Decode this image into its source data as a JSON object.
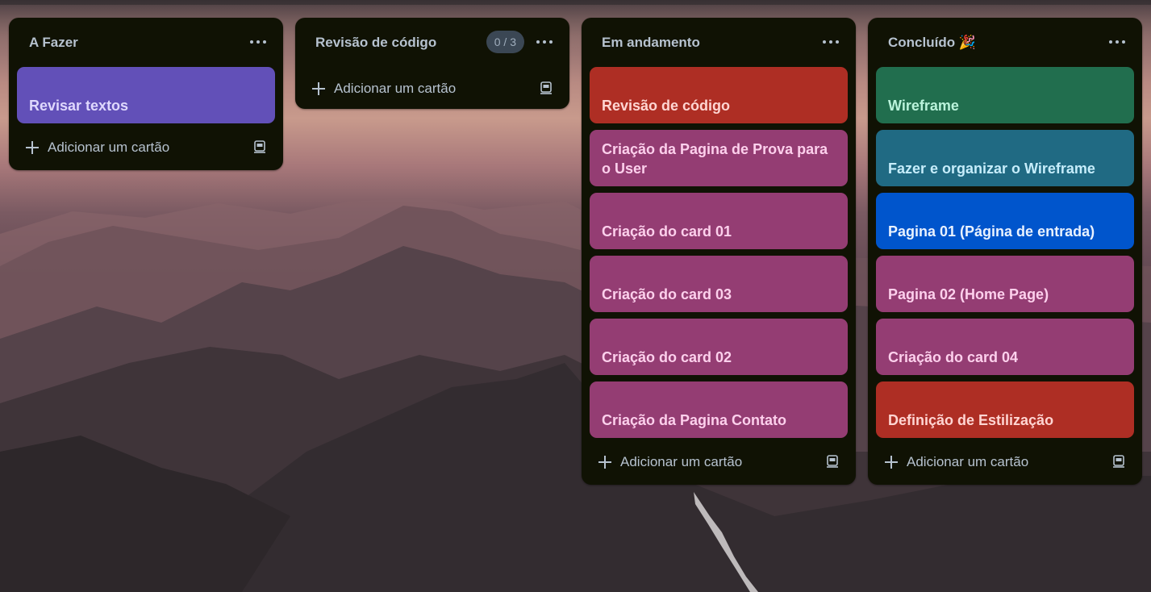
{
  "colors": {
    "list_bg": "#101204",
    "list_title": "#b6c2cf",
    "purple": "#6250b8",
    "red": "#ae2e24",
    "magenta": "#943d73",
    "green": "#216e4e",
    "teal": "#206a83",
    "blue": "#0055cc",
    "counter_bg": "#3b4754"
  },
  "lists": [
    {
      "title": "A Fazer",
      "cards": [
        {
          "title": "Revisar textos",
          "color": "#6250b8",
          "text_color": "#dfd8fd"
        }
      ],
      "add_label": "Adicionar um cartão"
    },
    {
      "title": "Revisão de código",
      "counter": "0 / 3",
      "cards": [],
      "add_label": "Adicionar um cartão"
    },
    {
      "title": "Em andamento",
      "cards": [
        {
          "title": "Revisão de código",
          "color": "#ae2e24",
          "text_color": "#ffd5d2"
        },
        {
          "title": "Criação da Pagina de Prova para o User",
          "color": "#943d73",
          "text_color": "#fdd0ec"
        },
        {
          "title": "Criação do card 01",
          "color": "#943d73",
          "text_color": "#fdd0ec"
        },
        {
          "title": "Criação do card 03",
          "color": "#943d73",
          "text_color": "#fdd0ec"
        },
        {
          "title": "Criação do card 02",
          "color": "#943d73",
          "text_color": "#fdd0ec"
        },
        {
          "title": "Criação da Pagina Contato",
          "color": "#943d73",
          "text_color": "#fdd0ec"
        }
      ],
      "add_label": "Adicionar um cartão"
    },
    {
      "title": "Concluído 🎉",
      "cards": [
        {
          "title": "Wireframe",
          "color": "#216e4e",
          "text_color": "#baf3db"
        },
        {
          "title": "Fazer e organizar o Wireframe",
          "color": "#206a83",
          "text_color": "#c6edfb"
        },
        {
          "title": "Pagina 01 (Página de entrada)",
          "color": "#0055cc",
          "text_color": "#e9f2ff"
        },
        {
          "title": "Pagina 02 (Home Page)",
          "color": "#943d73",
          "text_color": "#fdd0ec"
        },
        {
          "title": "Criação do card 04",
          "color": "#943d73",
          "text_color": "#fdd0ec"
        },
        {
          "title": "Definição de Estilização",
          "color": "#ae2e24",
          "text_color": "#ffd5d2"
        }
      ],
      "add_label": "Adicionar um cartão"
    }
  ],
  "icons": {
    "menu": "ellipsis-icon",
    "add": "plus-icon",
    "template": "card-template-icon"
  }
}
